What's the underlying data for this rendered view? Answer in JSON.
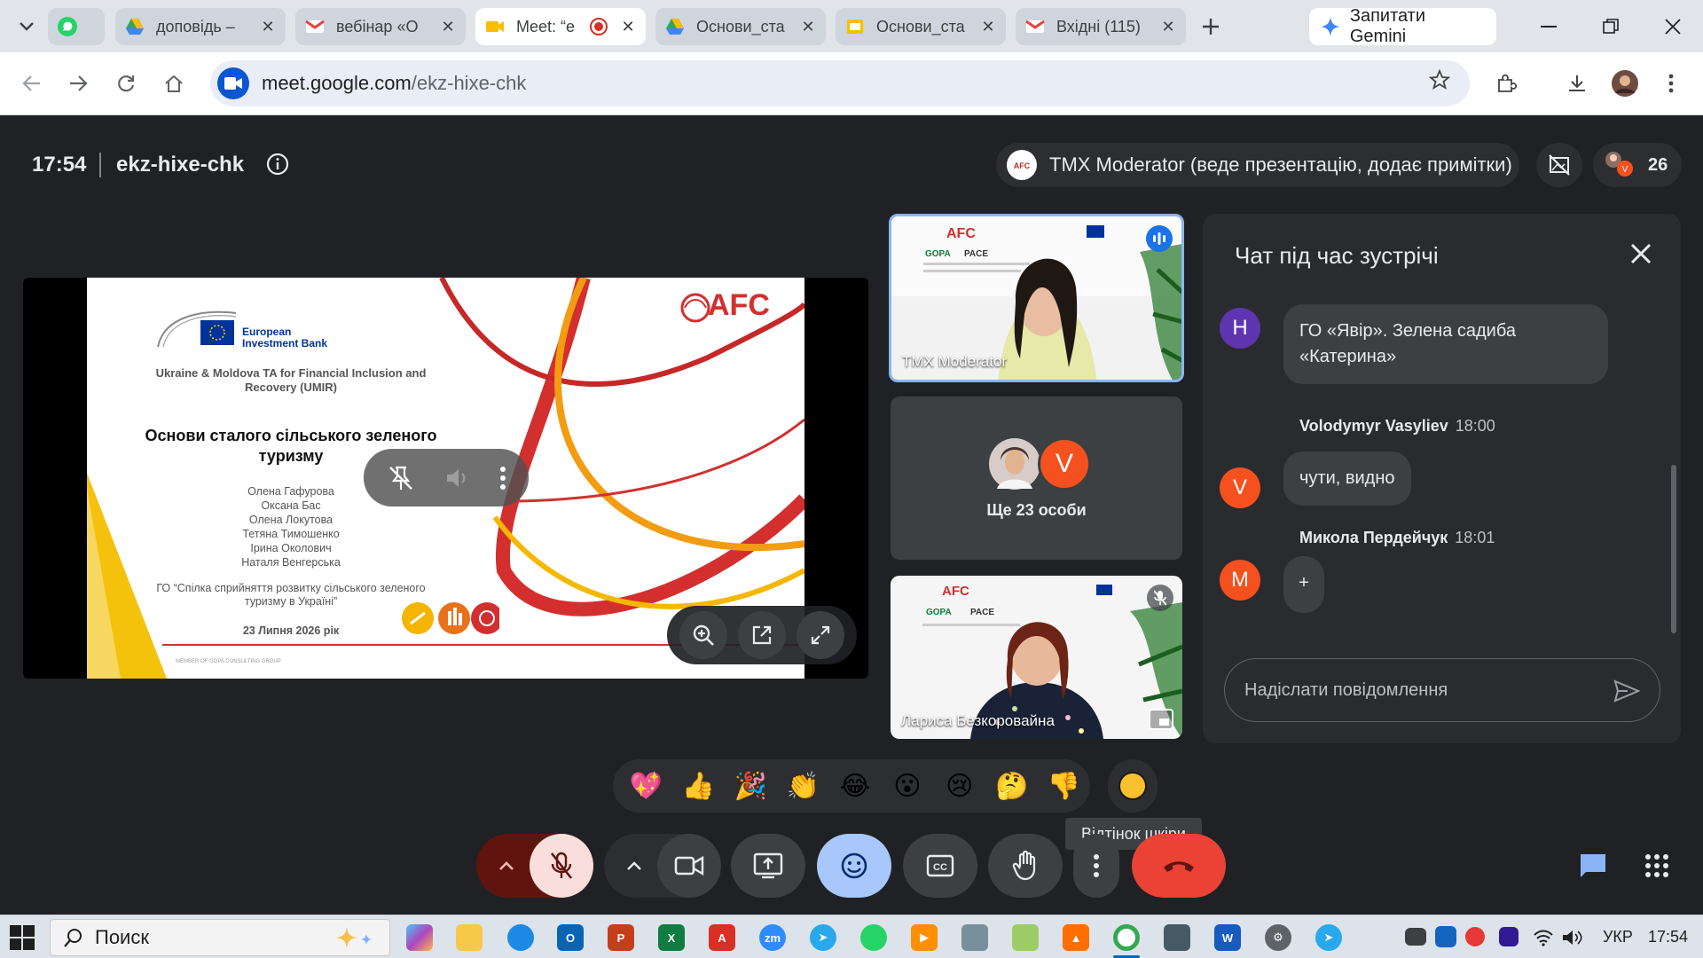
{
  "browser": {
    "tabs": [
      {
        "title": "",
        "icon": "whatsapp-icon"
      },
      {
        "title": "доповідь – ",
        "icon": "google-drive-icon"
      },
      {
        "title": "вебінар «О",
        "icon": "gmail-icon"
      },
      {
        "title": "Meet: “e",
        "icon": "google-meet-icon"
      },
      {
        "title": "Основи_ста",
        "icon": "google-drive-icon"
      },
      {
        "title": "Основи_ста",
        "icon": "google-slides-icon"
      },
      {
        "title": "Вхідні (115)",
        "icon": "gmail-icon"
      }
    ],
    "gemini_label": "Запитати Gemini",
    "url_host": "meet.google.com",
    "url_path": "/ekz-hixe-chk"
  },
  "meet": {
    "time": "17:54",
    "meeting_code": "ekz-hixe-chk",
    "presenter_label": "TMX Moderator (веде презентацію, додає примітки)",
    "participant_count": "26",
    "slide": {
      "bank_name_1": "European",
      "bank_name_2": "Investment Bank",
      "logo_afc": "AFC",
      "project": "Ukraine & Moldova TA for Financial Inclusion and Recovery (UMIR)",
      "title": "Основи сталого сільського зеленого туризму",
      "authors": [
        "Олена Гафурова",
        "Оксана Бас",
        "Олена Локутова",
        "Тетяна Тимошенко",
        "Ірина Околович",
        "Наталя Венгерська"
      ],
      "org": "ГО “Спілка сприйняття розвитку сільського зеленого туризму в Україні”",
      "date": "23 Липня 2026 рік",
      "footer": "MEMBER OF GOPA CONSULTING GROUP"
    },
    "tiles": {
      "tile1_name": "TMX Moderator",
      "tile2_more": "Ще 23 особи",
      "tile2_avatar_letter": "V",
      "tile3_name": "Лариса Безкоровайна"
    },
    "chat": {
      "title": "Чат під час зустрічі",
      "messages": [
        {
          "avatar": "H",
          "avatar_color": "#5e35b1",
          "sender": "",
          "time": "",
          "text": "ГО «Явір». Зелена садиба «Катерина»"
        },
        {
          "avatar": "V",
          "avatar_color": "#f4511e",
          "sender": "Volodymyr Vasyliev",
          "time": "18:00",
          "text": "чути, видно"
        },
        {
          "avatar": "M",
          "avatar_color": "#f4511e",
          "sender": "Микола Пердейчук",
          "time": "18:01",
          "text": "+"
        }
      ],
      "input_placeholder": "Надіслати повідомлення"
    },
    "reactions": [
      "💖",
      "👍",
      "🎉",
      "👏",
      "😂",
      "😮",
      "😢",
      "🤔",
      "👎"
    ],
    "tooltip": "Відтінок шкіри"
  },
  "taskbar": {
    "search_label": "Поиск",
    "language": "УКР",
    "time": "17:54"
  },
  "colors": {
    "meet_bg": "#202124",
    "end_call": "#ea4335",
    "mic_off": "#f9dedc",
    "reactions_active": "#a8c7fa"
  }
}
